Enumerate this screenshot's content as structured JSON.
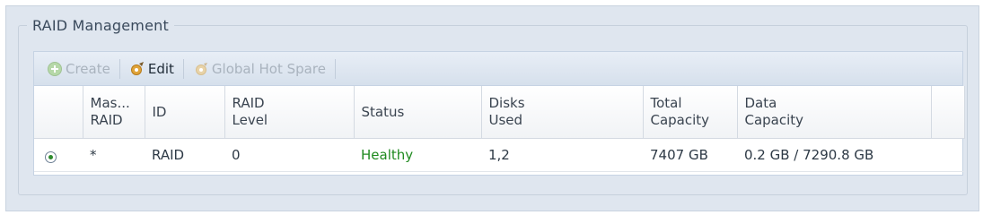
{
  "section": {
    "title": "RAID Management"
  },
  "toolbar": {
    "create_label": "Create",
    "edit_label": "Edit",
    "hot_spare_label": "Global Hot Spare"
  },
  "table": {
    "headers": {
      "master_raid": [
        "Mas...",
        "RAID"
      ],
      "id": "ID",
      "raid_level": [
        "RAID",
        "Level"
      ],
      "status": "Status",
      "disks_used": [
        "Disks",
        "Used"
      ],
      "total_capacity": [
        "Total",
        "Capacity"
      ],
      "data_capacity": [
        "Data",
        "Capacity"
      ]
    },
    "rows": [
      {
        "selected": true,
        "master_raid": "*",
        "id": "RAID",
        "raid_level": "0",
        "status": "Healthy",
        "disks_used": "1,2",
        "total_capacity": "7407 GB",
        "data_capacity": "0.2 GB / 7290.8 GB"
      }
    ]
  },
  "colors": {
    "status_healthy": "#1f8a1f"
  },
  "icons": {
    "create": "add-circle-icon",
    "edit": "gear-edit-icon",
    "hot_spare": "gear-icon"
  }
}
